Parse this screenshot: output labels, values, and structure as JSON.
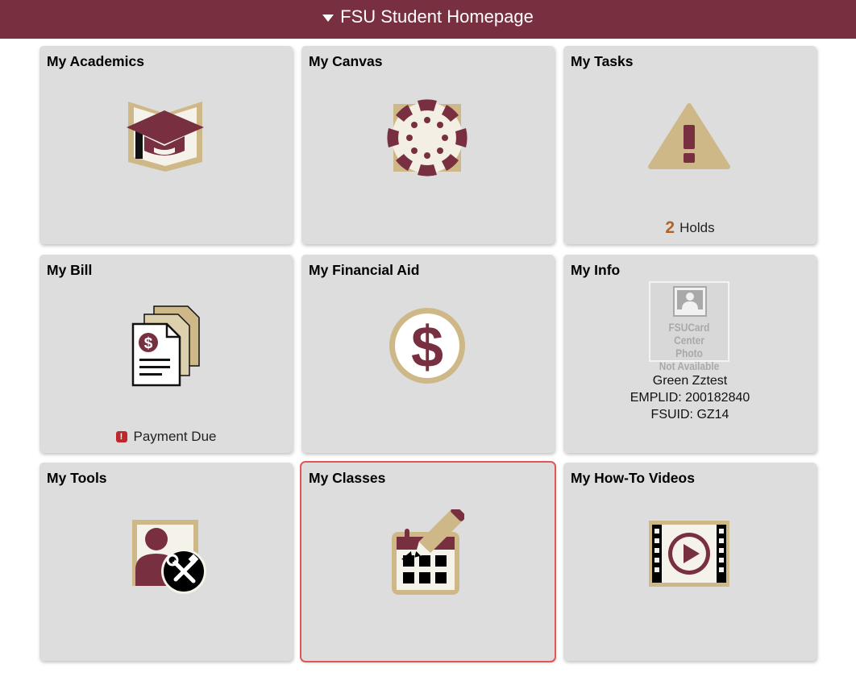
{
  "header": {
    "title": "FSU Student Homepage"
  },
  "tiles": {
    "academics": {
      "title": "My Academics"
    },
    "canvas": {
      "title": "My Canvas"
    },
    "tasks": {
      "title": "My Tasks",
      "count": "2",
      "status": "Holds"
    },
    "bill": {
      "title": "My Bill",
      "status": "Payment Due",
      "alert_glyph": "!"
    },
    "financial_aid": {
      "title": "My Financial Aid"
    },
    "info": {
      "title": "My Info",
      "photo_lines": [
        "FSUCard Center",
        "Photo",
        "Not Available"
      ],
      "name": "Green Zztest",
      "emplid": "EMPLID: 200182840",
      "fsuid": "FSUID: GZ14"
    },
    "tools": {
      "title": "My Tools"
    },
    "classes": {
      "title": "My Classes"
    },
    "videos": {
      "title": "My How-To Videos"
    }
  },
  "icons": {
    "academics": "graduation-cap-book-icon",
    "canvas": "canvas-logo-icon",
    "tasks": "warning-triangle-icon",
    "bill": "bill-documents-icon",
    "financial_aid": "dollar-circle-icon",
    "tools": "person-tools-icon",
    "classes": "calendar-pencil-icon",
    "videos": "video-film-icon"
  },
  "colors": {
    "garnet": "#782f40",
    "gold": "#ceb888",
    "tile_bg": "#dddddd",
    "selection_outline": "#e05555"
  }
}
